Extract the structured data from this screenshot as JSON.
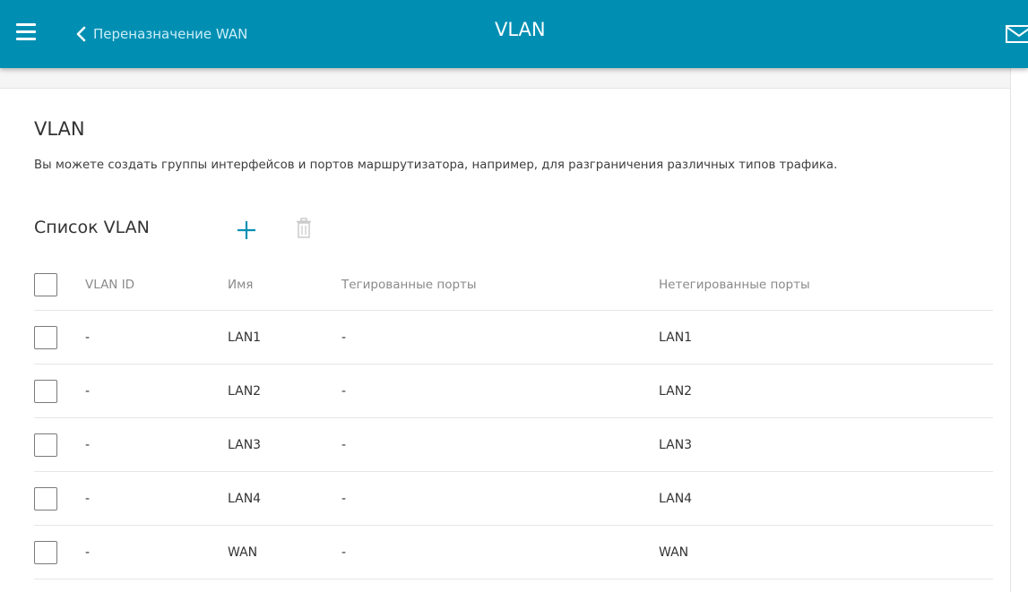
{
  "header": {
    "back_label": "Переназначение WAN",
    "title": "VLAN",
    "menu_icon": "hamburger-menu-icon",
    "back_icon": "chevron-left-icon",
    "notification_icon": "envelope-icon"
  },
  "section": {
    "title": "VLAN",
    "description": "Вы можете создать группы интерфейсов и портов маршрутизатора, например, для разграничения различных типов трафика."
  },
  "vlan_list": {
    "title": "Список VLAN",
    "add_icon": "plus-icon",
    "delete_icon": "trash-icon",
    "columns": {
      "vlan_id": "VLAN ID",
      "name": "Имя",
      "tagged": "Тегированные порты",
      "untagged": "Нетегированные порты"
    },
    "rows": [
      {
        "vlan_id": "-",
        "name": "LAN1",
        "tagged": "-",
        "untagged": "LAN1",
        "checked": false
      },
      {
        "vlan_id": "-",
        "name": "LAN2",
        "tagged": "-",
        "untagged": "LAN2",
        "checked": false
      },
      {
        "vlan_id": "-",
        "name": "LAN3",
        "tagged": "-",
        "untagged": "LAN3",
        "checked": false
      },
      {
        "vlan_id": "-",
        "name": "LAN4",
        "tagged": "-",
        "untagged": "LAN4",
        "checked": false
      },
      {
        "vlan_id": "-",
        "name": "WAN",
        "tagged": "-",
        "untagged": "WAN",
        "checked": false
      }
    ]
  },
  "colors": {
    "header_bg": "#008fb3",
    "accent": "#008fb3",
    "text": "#333333",
    "muted_text": "#8a8a8a"
  }
}
